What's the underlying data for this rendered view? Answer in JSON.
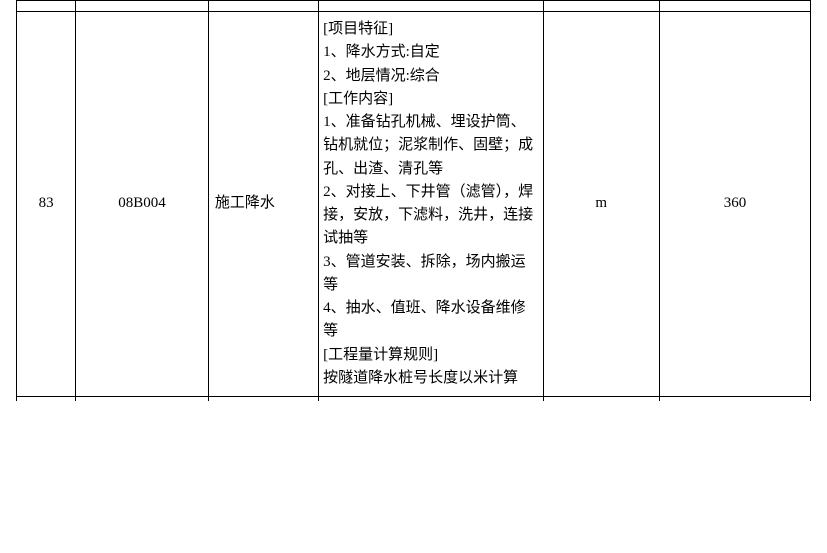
{
  "row": {
    "num": "83",
    "code": "08B004",
    "name": "施工降水",
    "description": "[项目特征]\n1、降水方式:自定\n2、地层情况:综合\n[工作内容]\n1、准备钻孔机械、埋设护筒、钻机就位；泥浆制作、固壁；成孔、出渣、清孔等\n2、对接上、下井管（滤管），焊接，安放，下滤料，洗井，连接试抽等\n3、管道安装、拆除，场内搬运等\n4、抽水、值班、降水设备维修等\n[工程量计算规则]\n按隧道降水桩号长度以米计算",
    "unit": "m",
    "quantity": "360"
  }
}
